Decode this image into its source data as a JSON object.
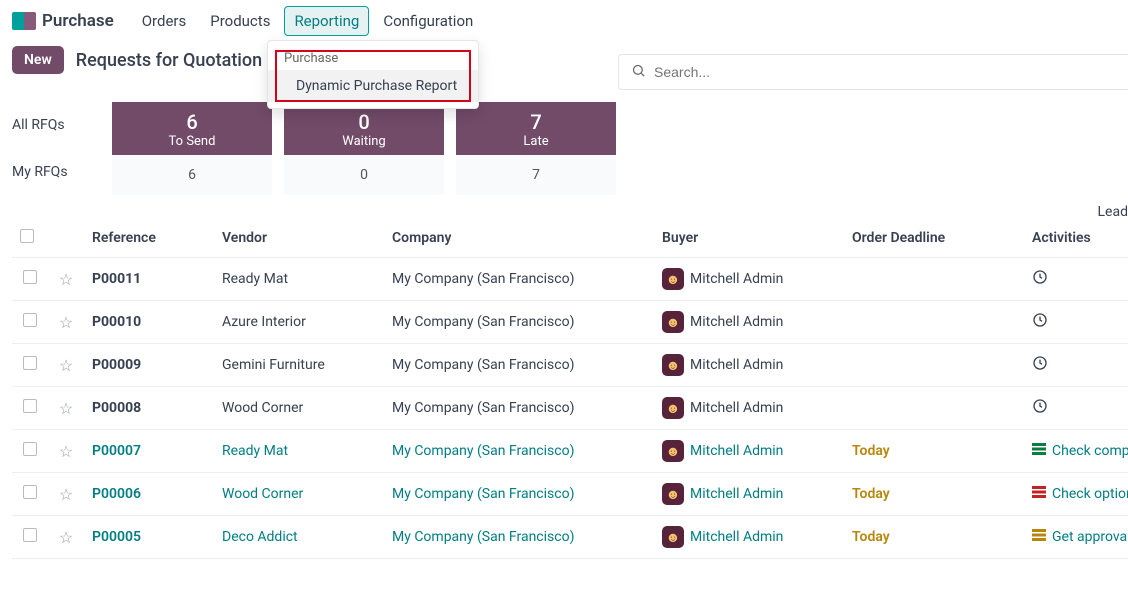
{
  "app": {
    "title": "Purchase"
  },
  "menu": {
    "orders": "Orders",
    "products": "Products",
    "reporting": "Reporting",
    "configuration": "Configuration"
  },
  "dropdown": {
    "header": "Purchase",
    "item": "Dynamic Purchase Report"
  },
  "subbar": {
    "new": "New",
    "title": "Requests for Quotation"
  },
  "search": {
    "placeholder": "Search..."
  },
  "filters": {
    "all": "All RFQs",
    "my": "My RFQs"
  },
  "stats": [
    {
      "big": "6",
      "label": "To Send",
      "small": "6"
    },
    {
      "big": "0",
      "label": "Waiting",
      "small": "0"
    },
    {
      "big": "7",
      "label": "Late",
      "small": "7"
    }
  ],
  "lead": "Lead",
  "columns": {
    "reference": "Reference",
    "vendor": "Vendor",
    "company": "Company",
    "buyer": "Buyer",
    "deadline": "Order Deadline",
    "activities": "Activities"
  },
  "buyer_name": "Mitchell Admin",
  "company_name": "My Company (San Francisco)",
  "deadline_today": "Today",
  "rows": [
    {
      "ref": "P00011",
      "vendor": "Ready Mat",
      "link": false,
      "deadline": "",
      "act_type": "clock",
      "act_text": ""
    },
    {
      "ref": "P00010",
      "vendor": "Azure Interior",
      "link": false,
      "deadline": "",
      "act_type": "clock",
      "act_text": ""
    },
    {
      "ref": "P00009",
      "vendor": "Gemini Furniture",
      "link": false,
      "deadline": "",
      "act_type": "clock",
      "act_text": ""
    },
    {
      "ref": "P00008",
      "vendor": "Wood Corner",
      "link": false,
      "deadline": "",
      "act_type": "clock",
      "act_text": ""
    },
    {
      "ref": "P00007",
      "vendor": "Ready Mat",
      "link": true,
      "deadline": "Today",
      "act_type": "green",
      "act_text": "Check competitors"
    },
    {
      "ref": "P00006",
      "vendor": "Wood Corner",
      "link": true,
      "deadline": "Today",
      "act_type": "red",
      "act_text": "Check optional products"
    },
    {
      "ref": "P00005",
      "vendor": "Deco Addict",
      "link": true,
      "deadline": "Today",
      "act_type": "amber",
      "act_text": "Get approval"
    }
  ]
}
